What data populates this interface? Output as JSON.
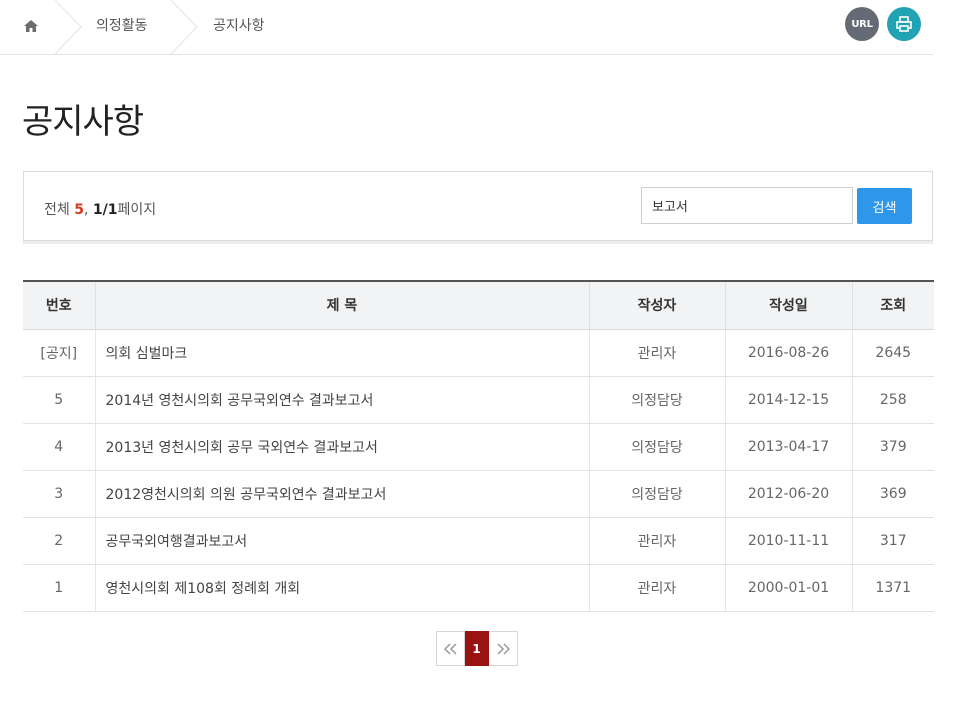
{
  "breadcrumb": {
    "home_icon": "home-icon",
    "items": [
      "의정활동",
      "공지사항"
    ]
  },
  "actions": {
    "url_label": "URL",
    "print_icon": "print-icon",
    "url_color": "#646b74",
    "print_color": "#22a3b4"
  },
  "page": {
    "title": "공지사항"
  },
  "search": {
    "total_prefix": "전체 ",
    "total_count": "5",
    "separator": ", ",
    "page_info": "1/1",
    "page_suffix": "페이지",
    "value": "보고서",
    "button_label": "검색",
    "button_color": "#2e97ea"
  },
  "table": {
    "headers": [
      "번호",
      "제 목",
      "작성자",
      "작성일",
      "조회"
    ],
    "rows": [
      {
        "no": "[공지]",
        "title": "의회 심벌마크",
        "author": "관리자",
        "date": "2016-08-26",
        "views": "2645"
      },
      {
        "no": "5",
        "title": "2014년 영천시의회 공무국외연수 결과보고서",
        "author": "의정담당",
        "date": "2014-12-15",
        "views": "258"
      },
      {
        "no": "4",
        "title": "2013년 영천시의회 공무 국외연수 결과보고서",
        "author": "의정담당",
        "date": "2013-04-17",
        "views": "379"
      },
      {
        "no": "3",
        "title": "2012영천시의회 의원 공무국외연수 결과보고서",
        "author": "의정담당",
        "date": "2012-06-20",
        "views": "369"
      },
      {
        "no": "2",
        "title": "공무국외여행결과보고서",
        "author": "관리자",
        "date": "2010-11-11",
        "views": "317"
      },
      {
        "no": "1",
        "title": "영천시의회 제108회 정례회 개회",
        "author": "관리자",
        "date": "2000-01-01",
        "views": "1371"
      }
    ]
  },
  "pagination": {
    "prev_icon": "double-chevron-left-icon",
    "current": "1",
    "next_icon": "double-chevron-right-icon",
    "active_color": "#9a1212"
  }
}
